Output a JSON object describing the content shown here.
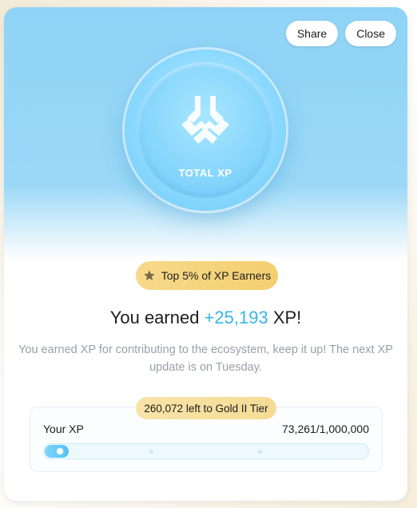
{
  "header": {
    "share_label": "Share",
    "close_label": "Close"
  },
  "coin": {
    "label": "TOTAL XP",
    "icon": "xp-logo-icon"
  },
  "badge": {
    "icon": "star-icon",
    "text": "Top 5% of XP Earners"
  },
  "headline": {
    "prefix": "You earned ",
    "amount": "+25,193",
    "suffix": " XP!"
  },
  "description": "You earned XP for contributing to the ecosystem, keep it up! The next XP update is on Tuesday.",
  "progress": {
    "tier_chip": "260,072 left to Gold II Tier",
    "label": "Your XP",
    "value_text": "73,261/1,000,000",
    "current": 73261,
    "max": 1000000
  },
  "colors": {
    "accent": "#38b6ec",
    "gold": "#f3cf6f",
    "hero_blue": "#8fd3f6"
  }
}
